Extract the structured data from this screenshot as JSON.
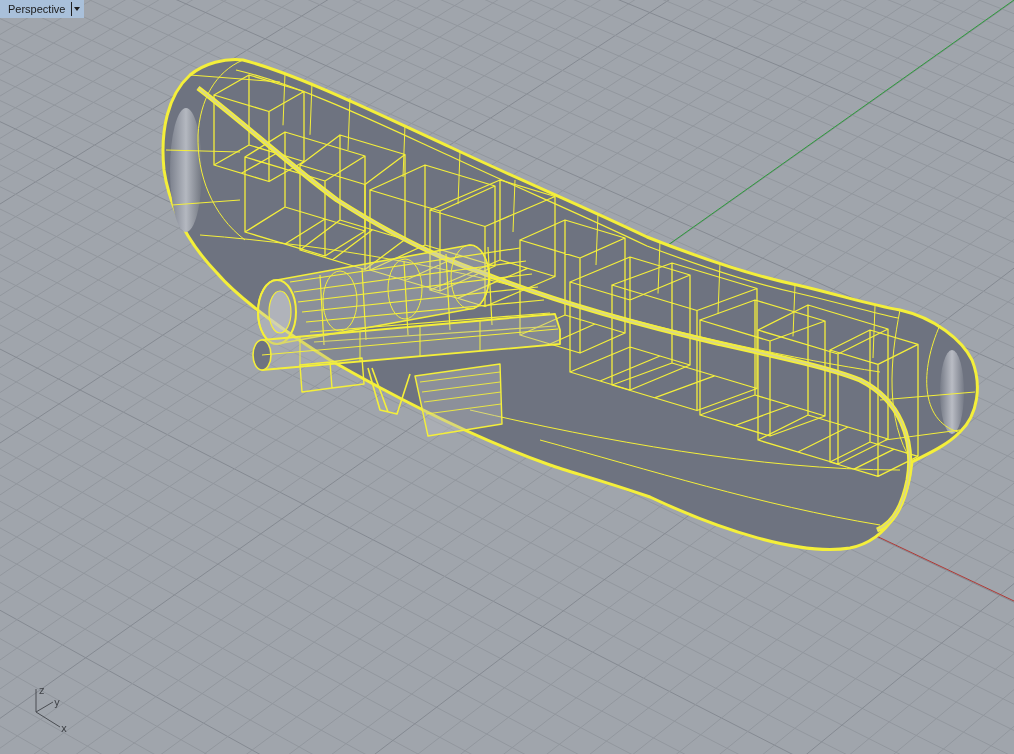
{
  "viewport": {
    "title": "Perspective"
  },
  "model": {
    "selected": true
  },
  "axis_gizmo": {
    "axes": [
      {
        "kind": "z",
        "label": "z"
      },
      {
        "kind": "y",
        "label": "y"
      },
      {
        "kind": "x",
        "label": "x"
      }
    ]
  }
}
